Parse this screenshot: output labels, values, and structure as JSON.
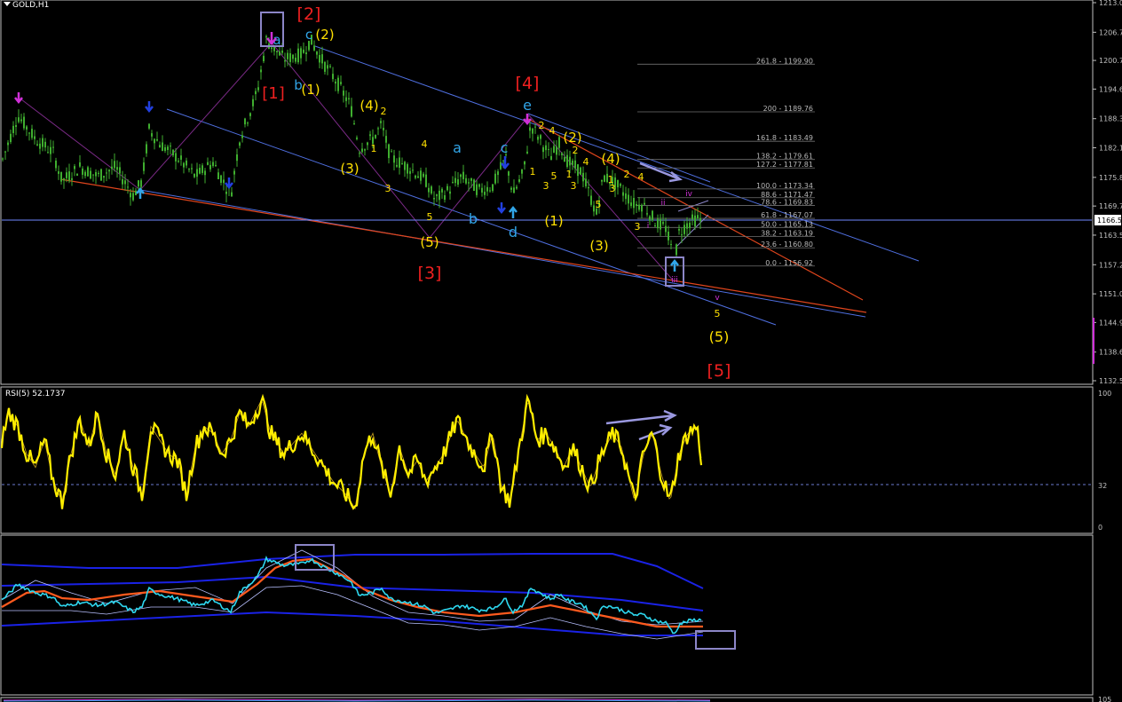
{
  "colors": {
    "background": "#000000",
    "frame": "#c0c0c0",
    "candles": "#3fae2f",
    "channel": "#4f6fe0",
    "redline": "#e0451c",
    "fib": "#b8b8b8",
    "rsi": "#ffee00",
    "hline": "#7088ff",
    "bandBlue": "#1a22e6",
    "bandCyan": "#2ed8f0",
    "bandOrange": "#ff5a1e",
    "bandThin": "#b8c0ff",
    "waveRed": "#ee2020",
    "waveYellow": "#ffe000",
    "waveCyan": "#31a5e8",
    "waveMagenta": "#d030d8",
    "box": "#8c86c8"
  },
  "main": {
    "title": "GOLD,H1",
    "current_price": "1166.5",
    "y_ticks": [
      "1213.0",
      "1206.7",
      "1200.7",
      "1194.6",
      "1188.3",
      "1182.1",
      "1175.8",
      "1169.7",
      "1163.5",
      "1157.2",
      "1151.0",
      "1144.9",
      "1138.6",
      "1132.5"
    ]
  },
  "fib": [
    {
      "label": "261.8 - 1199.90",
      "price": 1199.9
    },
    {
      "label": "200 - 1189.76",
      "price": 1189.76
    },
    {
      "label": "161.8 - 1183.49",
      "price": 1183.49
    },
    {
      "label": "138.2 - 1179.61",
      "price": 1179.61
    },
    {
      "label": "127.2 - 1177.81",
      "price": 1177.81
    },
    {
      "label": "100.0 - 1173.34",
      "price": 1173.34
    },
    {
      "label": "88.6 - 1171.47",
      "price": 1171.47
    },
    {
      "label": "78.6 - 1169.83",
      "price": 1169.83
    },
    {
      "label": "61.8 - 1167.07",
      "price": 1167.07
    },
    {
      "label": "50.0 - 1165.13",
      "price": 1165.13
    },
    {
      "label": "38.2 - 1163.19",
      "price": 1163.19
    },
    {
      "label": "23.6 - 1160.80",
      "price": 1160.8
    },
    {
      "label": "0.0 - 1156.92",
      "price": 1156.92
    }
  ],
  "rsi": {
    "title": "RSI(5) 52.1737",
    "ticks": [
      "100",
      "32",
      "0"
    ]
  },
  "bottom": {
    "tick": "105"
  },
  "wave_labels": [
    {
      "t": "[1]",
      "c": "waveRed",
      "s": 18,
      "x": 308,
      "y": 111
    },
    {
      "t": "[2]",
      "c": "waveRed",
      "s": 19,
      "x": 348,
      "y": 22
    },
    {
      "t": "[3]",
      "c": "waveRed",
      "s": 19,
      "x": 484,
      "y": 314
    },
    {
      "t": "[4]",
      "c": "waveRed",
      "s": 19,
      "x": 594,
      "y": 100
    },
    {
      "t": "[5]",
      "c": "waveRed",
      "s": 19,
      "x": 810,
      "y": 424
    },
    {
      "t": "a",
      "c": "waveCyan",
      "s": 15,
      "x": 312,
      "y": 50
    },
    {
      "t": "b",
      "c": "waveCyan",
      "s": 15,
      "x": 336,
      "y": 101
    },
    {
      "t": "c",
      "c": "waveCyan",
      "s": 15,
      "x": 348,
      "y": 44
    },
    {
      "t": "(2)",
      "c": "waveYellow",
      "s": 15,
      "x": 366,
      "y": 44
    },
    {
      "t": "(1)",
      "c": "waveYellow",
      "s": 15,
      "x": 350,
      "y": 106
    },
    {
      "t": "(4)",
      "c": "waveYellow",
      "s": 15,
      "x": 416,
      "y": 124
    },
    {
      "t": "2",
      "c": "waveYellow",
      "s": 11,
      "x": 432,
      "y": 129
    },
    {
      "t": "1",
      "c": "waveYellow",
      "s": 11,
      "x": 421,
      "y": 171
    },
    {
      "t": "4",
      "c": "waveYellow",
      "s": 11,
      "x": 478,
      "y": 166
    },
    {
      "t": "a",
      "c": "waveCyan",
      "s": 16,
      "x": 515,
      "y": 172
    },
    {
      "t": "c",
      "c": "waveCyan",
      "s": 16,
      "x": 568,
      "y": 172
    },
    {
      "t": "(3)",
      "c": "waveYellow",
      "s": 15,
      "x": 394,
      "y": 195
    },
    {
      "t": "3",
      "c": "waveYellow",
      "s": 11,
      "x": 437,
      "y": 216
    },
    {
      "t": "5",
      "c": "waveYellow",
      "s": 11,
      "x": 484,
      "y": 248
    },
    {
      "t": "b",
      "c": "waveCyan",
      "s": 16,
      "x": 533,
      "y": 252
    },
    {
      "t": "d",
      "c": "waveCyan",
      "s": 16,
      "x": 578,
      "y": 267
    },
    {
      "t": "(5)",
      "c": "waveYellow",
      "s": 15,
      "x": 484,
      "y": 278
    },
    {
      "t": "e",
      "c": "waveCyan",
      "s": 16,
      "x": 594,
      "y": 124
    },
    {
      "t": "2",
      "c": "waveYellow",
      "s": 11,
      "x": 610,
      "y": 145
    },
    {
      "t": "4",
      "c": "waveYellow",
      "s": 11,
      "x": 622,
      "y": 151
    },
    {
      "t": "(2)",
      "c": "waveYellow",
      "s": 15,
      "x": 645,
      "y": 160
    },
    {
      "t": "2",
      "c": "waveYellow",
      "s": 11,
      "x": 648,
      "y": 173
    },
    {
      "t": "4",
      "c": "waveYellow",
      "s": 11,
      "x": 660,
      "y": 186
    },
    {
      "t": "(4)",
      "c": "waveYellow",
      "s": 15,
      "x": 688,
      "y": 184
    },
    {
      "t": "2",
      "c": "waveYellow",
      "s": 11,
      "x": 706,
      "y": 200
    },
    {
      "t": "4",
      "c": "waveYellow",
      "s": 11,
      "x": 722,
      "y": 203
    },
    {
      "t": "1",
      "c": "waveYellow",
      "s": 11,
      "x": 600,
      "y": 197
    },
    {
      "t": "3",
      "c": "waveYellow",
      "s": 11,
      "x": 615,
      "y": 213
    },
    {
      "t": "1",
      "c": "waveYellow",
      "s": 11,
      "x": 641,
      "y": 200
    },
    {
      "t": "3",
      "c": "waveYellow",
      "s": 11,
      "x": 646,
      "y": 213
    },
    {
      "t": "1",
      "c": "waveYellow",
      "s": 11,
      "x": 688,
      "y": 206
    },
    {
      "t": "3",
      "c": "waveYellow",
      "s": 11,
      "x": 690,
      "y": 216
    },
    {
      "t": "5",
      "c": "waveYellow",
      "s": 11,
      "x": 624,
      "y": 202
    },
    {
      "t": "(1)",
      "c": "waveYellow",
      "s": 15,
      "x": 624,
      "y": 254
    },
    {
      "t": "5",
      "c": "waveYellow",
      "s": 11,
      "x": 674,
      "y": 234
    },
    {
      "t": "(3)",
      "c": "waveYellow",
      "s": 15,
      "x": 675,
      "y": 282
    },
    {
      "t": "3",
      "c": "waveYellow",
      "s": 11,
      "x": 718,
      "y": 259
    },
    {
      "t": "ii",
      "c": "waveMagenta",
      "s": 9,
      "x": 747,
      "y": 231
    },
    {
      "t": "iv",
      "c": "waveMagenta",
      "s": 9,
      "x": 776,
      "y": 221
    },
    {
      "t": "i",
      "c": "waveMagenta",
      "s": 9,
      "x": 730,
      "y": 257
    },
    {
      "t": "iii",
      "c": "waveMagenta",
      "s": 9,
      "x": 760,
      "y": 318
    },
    {
      "t": "v",
      "c": "waveMagenta",
      "s": 9,
      "x": 808,
      "y": 338
    },
    {
      "t": "5",
      "c": "waveYellow",
      "s": 11,
      "x": 808,
      "y": 357
    },
    {
      "t": "(5)",
      "c": "waveYellow",
      "s": 16,
      "x": 810,
      "y": 385
    }
  ],
  "chart_data": {
    "type": "candlestick",
    "symbol": "GOLD",
    "timeframe": "H1",
    "y_axis_ticks": [
      1213.0,
      1206.7,
      1200.7,
      1194.6,
      1188.3,
      1182.1,
      1175.8,
      1169.7,
      1163.5,
      1157.2,
      1151.0,
      1144.9,
      1138.6,
      1132.5
    ],
    "ylim": [
      1132.5,
      1213.0
    ],
    "current_price": 1166.5,
    "price_path": [
      [
        0,
        1178
      ],
      [
        20,
        1189
      ],
      [
        40,
        1184
      ],
      [
        60,
        1181
      ],
      [
        70,
        1175
      ],
      [
        90,
        1178
      ],
      [
        110,
        1176
      ],
      [
        130,
        1178
      ],
      [
        150,
        1172
      ],
      [
        160,
        1175
      ],
      [
        168,
        1186
      ],
      [
        180,
        1183
      ],
      [
        200,
        1180
      ],
      [
        220,
        1176
      ],
      [
        240,
        1179
      ],
      [
        260,
        1172
      ],
      [
        270,
        1184
      ],
      [
        290,
        1194
      ],
      [
        300,
        1205
      ],
      [
        320,
        1201
      ],
      [
        340,
        1202
      ],
      [
        350,
        1205
      ],
      [
        365,
        1200
      ],
      [
        380,
        1196
      ],
      [
        395,
        1191
      ],
      [
        405,
        1182
      ],
      [
        420,
        1184
      ],
      [
        430,
        1187
      ],
      [
        440,
        1180
      ],
      [
        460,
        1178
      ],
      [
        480,
        1175
      ],
      [
        490,
        1171
      ],
      [
        505,
        1173
      ],
      [
        520,
        1176
      ],
      [
        540,
        1173
      ],
      [
        555,
        1174
      ],
      [
        570,
        1180
      ],
      [
        578,
        1172
      ],
      [
        590,
        1177
      ],
      [
        598,
        1187
      ],
      [
        608,
        1184
      ],
      [
        620,
        1180
      ],
      [
        630,
        1183
      ],
      [
        640,
        1179
      ],
      [
        655,
        1177
      ],
      [
        672,
        1168
      ],
      [
        680,
        1176
      ],
      [
        690,
        1175
      ],
      [
        705,
        1172
      ],
      [
        715,
        1170
      ],
      [
        725,
        1170
      ],
      [
        732,
        1168
      ],
      [
        740,
        1166
      ],
      [
        750,
        1165
      ],
      [
        760,
        1158
      ],
      [
        765,
        1164
      ],
      [
        775,
        1166
      ],
      [
        785,
        1167
      ],
      [
        790,
        1166.5
      ]
    ],
    "fib_levels": [
      {
        "ratio": 261.8,
        "price": 1199.9
      },
      {
        "ratio": 200,
        "price": 1189.76
      },
      {
        "ratio": 161.8,
        "price": 1183.49
      },
      {
        "ratio": 138.2,
        "price": 1179.61
      },
      {
        "ratio": 127.2,
        "price": 1177.81
      },
      {
        "ratio": 100.0,
        "price": 1173.34
      },
      {
        "ratio": 88.6,
        "price": 1171.47
      },
      {
        "ratio": 78.6,
        "price": 1169.83
      },
      {
        "ratio": 61.8,
        "price": 1167.07
      },
      {
        "ratio": 50.0,
        "price": 1165.13
      },
      {
        "ratio": 38.2,
        "price": 1163.19
      },
      {
        "ratio": 23.6,
        "price": 1160.8
      },
      {
        "ratio": 0.0,
        "price": 1156.92
      }
    ],
    "rsi": {
      "name": "RSI(5)",
      "last": 52.1737,
      "levels": [
        100,
        32,
        0
      ],
      "path": [
        [
          0,
          60
        ],
        [
          10,
          85
        ],
        [
          20,
          75
        ],
        [
          30,
          55
        ],
        [
          40,
          45
        ],
        [
          50,
          65
        ],
        [
          60,
          35
        ],
        [
          70,
          20
        ],
        [
          80,
          55
        ],
        [
          90,
          80
        ],
        [
          100,
          60
        ],
        [
          110,
          85
        ],
        [
          120,
          55
        ],
        [
          130,
          40
        ],
        [
          140,
          70
        ],
        [
          150,
          45
        ],
        [
          160,
          25
        ],
        [
          170,
          75
        ],
        [
          180,
          65
        ],
        [
          190,
          55
        ],
        [
          200,
          50
        ],
        [
          210,
          25
        ],
        [
          220,
          60
        ],
        [
          230,
          75
        ],
        [
          240,
          70
        ],
        [
          250,
          55
        ],
        [
          260,
          65
        ],
        [
          270,
          85
        ],
        [
          280,
          75
        ],
        [
          295,
          95
        ],
        [
          305,
          70
        ],
        [
          320,
          55
        ],
        [
          340,
          70
        ],
        [
          360,
          50
        ],
        [
          375,
          35
        ],
        [
          390,
          25
        ],
        [
          400,
          15
        ],
        [
          410,
          55
        ],
        [
          420,
          70
        ],
        [
          430,
          45
        ],
        [
          440,
          25
        ],
        [
          450,
          60
        ],
        [
          460,
          40
        ],
        [
          470,
          50
        ],
        [
          480,
          35
        ],
        [
          490,
          45
        ],
        [
          500,
          55
        ],
        [
          515,
          80
        ],
        [
          530,
          60
        ],
        [
          545,
          45
        ],
        [
          555,
          70
        ],
        [
          565,
          30
        ],
        [
          575,
          20
        ],
        [
          585,
          60
        ],
        [
          595,
          95
        ],
        [
          605,
          65
        ],
        [
          615,
          70
        ],
        [
          625,
          60
        ],
        [
          635,
          45
        ],
        [
          645,
          60
        ],
        [
          655,
          45
        ],
        [
          665,
          30
        ],
        [
          675,
          50
        ],
        [
          690,
          70
        ],
        [
          700,
          60
        ],
        [
          715,
          20
        ],
        [
          725,
          55
        ],
        [
          735,
          70
        ],
        [
          745,
          40
        ],
        [
          755,
          20
        ],
        [
          765,
          55
        ],
        [
          775,
          70
        ],
        [
          785,
          75
        ],
        [
          790,
          52
        ]
      ]
    }
  }
}
